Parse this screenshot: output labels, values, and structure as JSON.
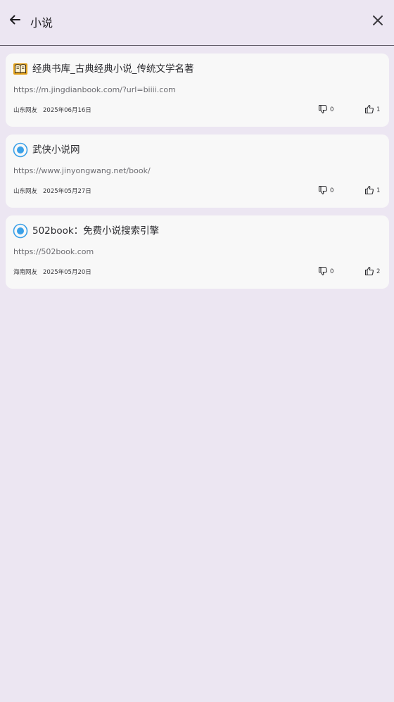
{
  "header": {
    "search_value": "小说"
  },
  "results": [
    {
      "icon": "book-icon",
      "title": "经典书库_古典经典小说_传统文学名著",
      "url": "https://m.jingdianbook.com/?url=biiii.com",
      "author": "山东网友",
      "date": "2025年06月16日",
      "dislikes": "0",
      "likes": "1"
    },
    {
      "icon": "radio-dot-icon",
      "title": "武侠小说网",
      "url": "https://www.jinyongwang.net/book/",
      "author": "山东网友",
      "date": "2025年05月27日",
      "dislikes": "0",
      "likes": "1"
    },
    {
      "icon": "radio-dot-icon",
      "title": "502book：免费小说搜索引擎",
      "url": "https://502book.com",
      "author": "海南网友",
      "date": "2025年05月20日",
      "dislikes": "0",
      "likes": "2"
    }
  ],
  "colors": {
    "background": "#ece6f2",
    "card": "#f8f8f8",
    "accent_blue": "#3aa0e8",
    "book_gold": "#e2a11b"
  }
}
